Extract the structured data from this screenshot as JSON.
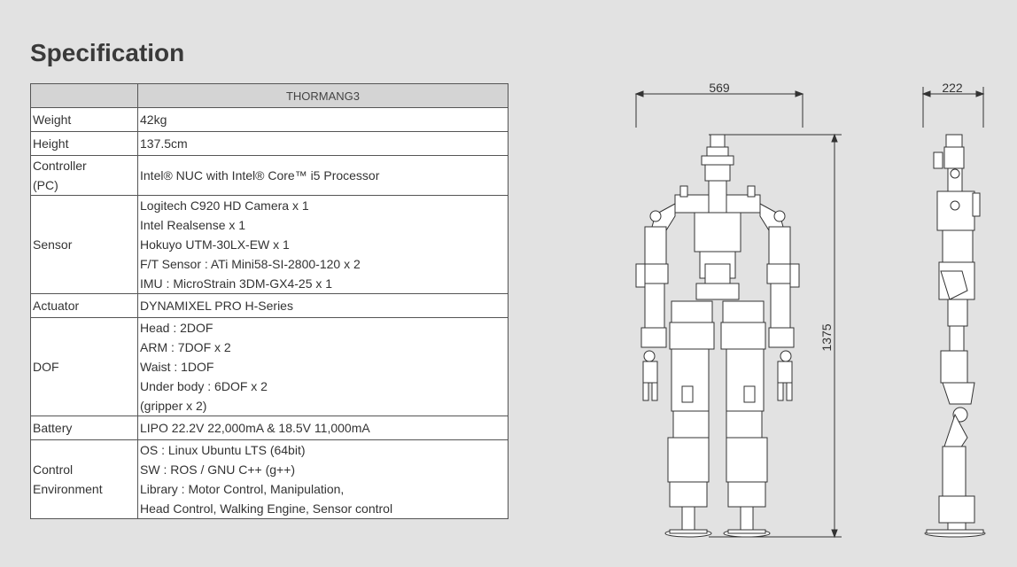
{
  "page": {
    "title": "Specification"
  },
  "table": {
    "header": [
      "",
      "THORMANG3"
    ],
    "rows": [
      {
        "label": [
          "Weight"
        ],
        "values": [
          "42kg"
        ]
      },
      {
        "label": [
          "Height"
        ],
        "values": [
          "137.5cm"
        ]
      },
      {
        "label": [
          "Controller",
          "(PC)"
        ],
        "values": [
          "Intel® NUC with Intel® Core™ i5 Processor"
        ]
      },
      {
        "label": [
          "Sensor"
        ],
        "values": [
          "Logitech C920 HD Camera x 1",
          "Intel Realsense x 1",
          "Hokuyo UTM-30LX-EW x 1",
          "F/T Sensor : ATi Mini58-SI-2800-120 x 2",
          "IMU : MicroStrain 3DM-GX4-25 x 1"
        ]
      },
      {
        "label": [
          "Actuator"
        ],
        "values": [
          "DYNAMIXEL PRO H-Series"
        ]
      },
      {
        "label": [
          "DOF"
        ],
        "values": [
          "Head : 2DOF",
          "ARM : 7DOF x 2",
          "Waist : 1DOF",
          "Under body : 6DOF x 2",
          "(gripper x 2)"
        ]
      },
      {
        "label": [
          "Battery"
        ],
        "values": [
          "LIPO 22.2V 22,000mA & 18.5V 11,000mA"
        ]
      },
      {
        "label": [
          "Control",
          "Environment"
        ],
        "values": [
          "OS : Linux Ubuntu LTS (64bit)",
          "SW : ROS / GNU C++ (g++)",
          "Library : Motor Control, Manipulation,",
          "Head Control, Walking Engine, Sensor control"
        ]
      }
    ]
  },
  "drawing": {
    "front_width": "569",
    "side_width": "222",
    "height": "1375"
  }
}
